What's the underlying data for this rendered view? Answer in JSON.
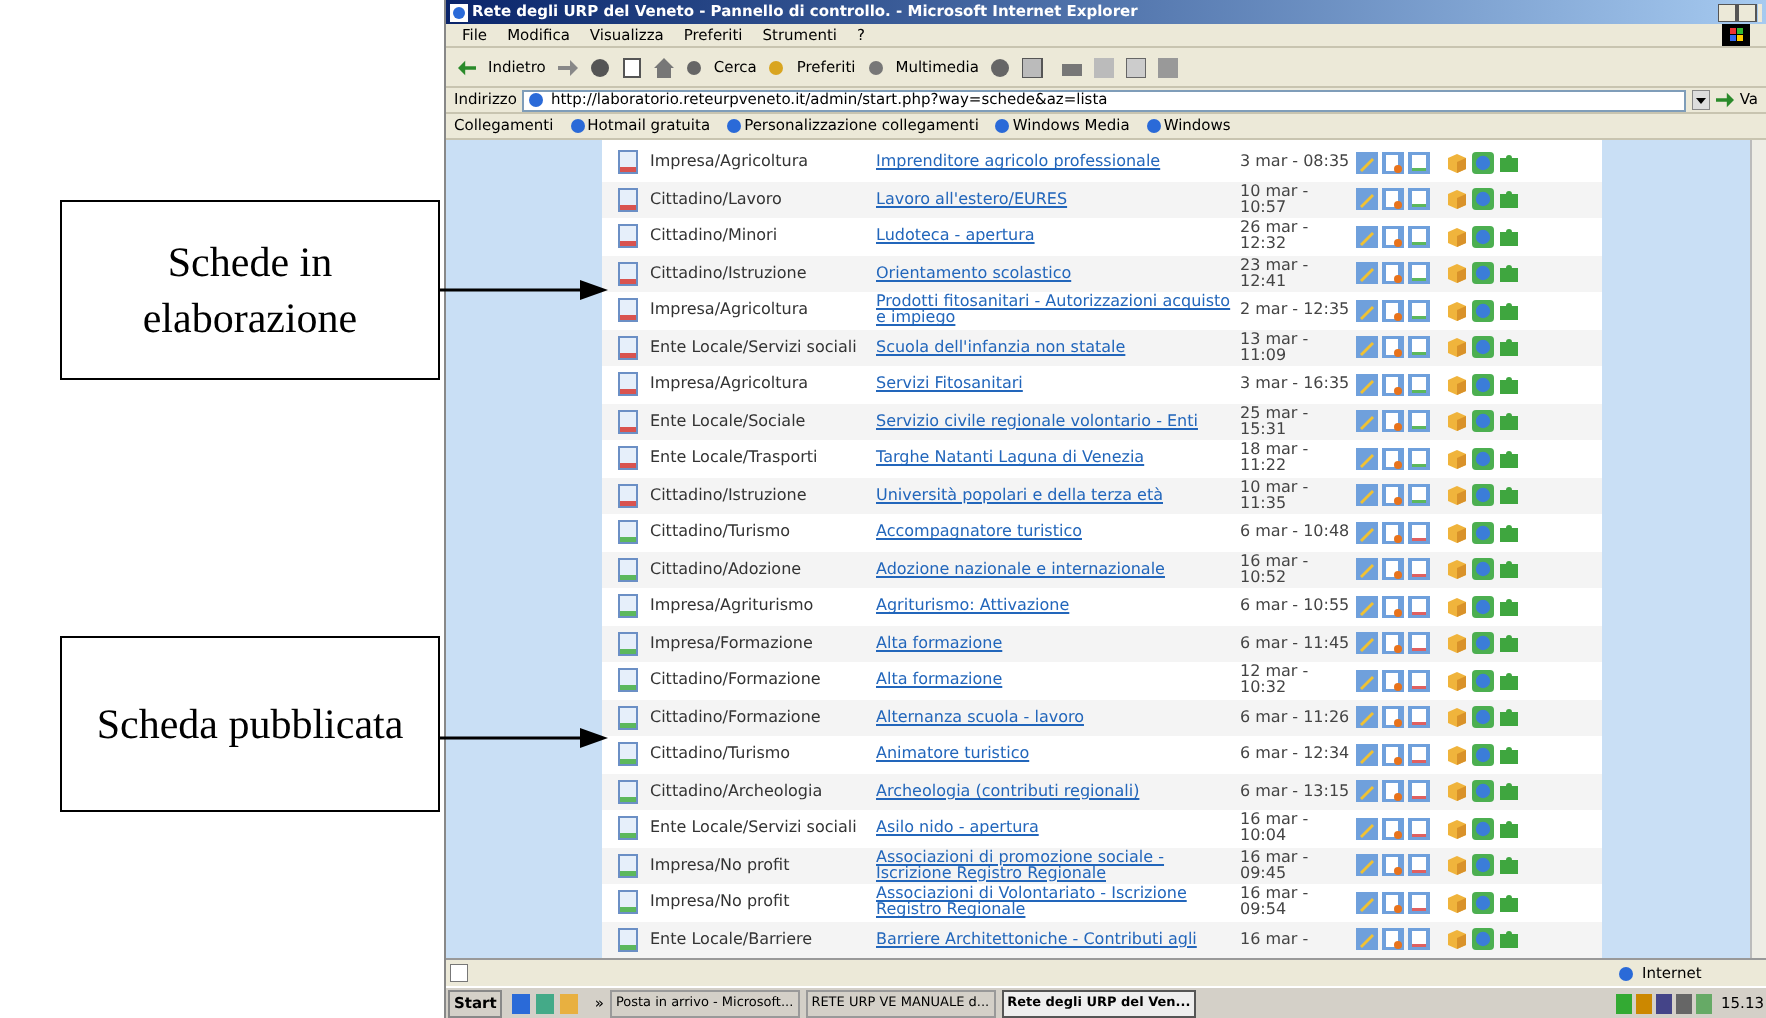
{
  "callouts": [
    {
      "text": "Schede in elaborazione"
    },
    {
      "text": "Scheda pubblicata"
    }
  ],
  "window": {
    "title": "Rete degli URP del Veneto - Pannello di controllo. - Microsoft Internet Explorer"
  },
  "menu": [
    "File",
    "Modifica",
    "Visualizza",
    "Preferiti",
    "Strumenti",
    "?"
  ],
  "toolbar": {
    "back": "Indietro",
    "search": "Cerca",
    "favorites": "Preferiti",
    "media": "Multimedia"
  },
  "address": {
    "label": "Indirizzo",
    "value": "http://laboratorio.reteurpveneto.it/admin/start.php?way=schede&az=lista",
    "go": "Va"
  },
  "links": {
    "label": "Collegamenti",
    "items": [
      "Hotmail gratuita",
      "Personalizzazione collegamenti",
      "Windows Media",
      "Windows"
    ]
  },
  "rows": [
    {
      "kind": "in_progress",
      "category": "Impresa/Agricoltura",
      "title": "Imprenditore agricolo professionale",
      "date": "3 mar - 08:35"
    },
    {
      "kind": "in_progress",
      "category": "Cittadino/Lavoro",
      "title": "Lavoro all'estero/EURES",
      "date": "10 mar - 10:57"
    },
    {
      "kind": "in_progress",
      "category": "Cittadino/Minori",
      "title": "Ludoteca - apertura",
      "date": "26 mar - 12:32"
    },
    {
      "kind": "in_progress",
      "category": "Cittadino/Istruzione",
      "title": "Orientamento scolastico",
      "date": "23 mar - 12:41"
    },
    {
      "kind": "in_progress",
      "category": "Impresa/Agricoltura",
      "title": "Prodotti fitosanitari - Autorizzazioni acquisto e impiego",
      "date": "2 mar - 12:35"
    },
    {
      "kind": "in_progress",
      "category": "Ente Locale/Servizi sociali",
      "title": "Scuola dell'infanzia non statale",
      "date": "13 mar - 11:09"
    },
    {
      "kind": "in_progress",
      "category": "Impresa/Agricoltura",
      "title": "Servizi Fitosanitari",
      "date": "3 mar - 16:35"
    },
    {
      "kind": "in_progress",
      "category": "Ente Locale/Sociale",
      "title": "Servizio civile regionale volontario - Enti",
      "date": "25 mar - 15:31"
    },
    {
      "kind": "in_progress",
      "category": "Ente Locale/Trasporti",
      "title": "Targhe Natanti Laguna di Venezia",
      "date": "18 mar - 11:22"
    },
    {
      "kind": "in_progress",
      "category": "Cittadino/Istruzione",
      "title": "Università popolari e della terza età",
      "date": "10 mar - 11:35"
    },
    {
      "kind": "published",
      "category": "Cittadino/Turismo",
      "title": "Accompagnatore turistico",
      "date": "6 mar - 10:48"
    },
    {
      "kind": "published",
      "category": "Cittadino/Adozione",
      "title": "Adozione nazionale e internazionale",
      "date": "16 mar - 10:52"
    },
    {
      "kind": "published",
      "category": "Impresa/Agriturismo",
      "title": "Agriturismo: Attivazione",
      "date": "6 mar - 10:55"
    },
    {
      "kind": "published",
      "category": "Impresa/Formazione",
      "title": "Alta formazione",
      "date": "6 mar - 11:45"
    },
    {
      "kind": "published",
      "category": "Cittadino/Formazione",
      "title": "Alta formazione",
      "date": "12 mar - 10:32"
    },
    {
      "kind": "published",
      "category": "Cittadino/Formazione",
      "title": "Alternanza scuola - lavoro",
      "date": "6 mar - 11:26"
    },
    {
      "kind": "published",
      "category": "Cittadino/Turismo",
      "title": "Animatore turistico",
      "date": "6 mar - 12:34"
    },
    {
      "kind": "published",
      "category": "Cittadino/Archeologia",
      "title": "Archeologia (contributi regionali)",
      "date": "6 mar - 13:15"
    },
    {
      "kind": "published",
      "category": "Ente Locale/Servizi sociali",
      "title": "Asilo nido - apertura",
      "date": "16 mar - 10:04"
    },
    {
      "kind": "published",
      "category": "Impresa/No profit",
      "title": "Associazioni di promozione sociale - Iscrizione Registro Regionale",
      "date": "16 mar - 09:45"
    },
    {
      "kind": "published",
      "category": "Impresa/No profit",
      "title": "Associazioni di Volontariato - Iscrizione Registro Regionale",
      "date": "16 mar - 09:54"
    },
    {
      "kind": "published",
      "category": "Ente Locale/Barriere",
      "title": "Barriere Architettoniche - Contributi agli",
      "date": "16 mar -"
    }
  ],
  "status_bar": {
    "zone": "Internet"
  },
  "taskbar": {
    "start": "Start",
    "more": "»",
    "tasks": [
      {
        "label": "Posta in arrivo - Microsoft...",
        "selected": false
      },
      {
        "label": "RETE URP VE MANUALE d...",
        "selected": false
      },
      {
        "label": "Rete degli URP del Ven...",
        "selected": true
      }
    ],
    "clock": "15.13"
  }
}
